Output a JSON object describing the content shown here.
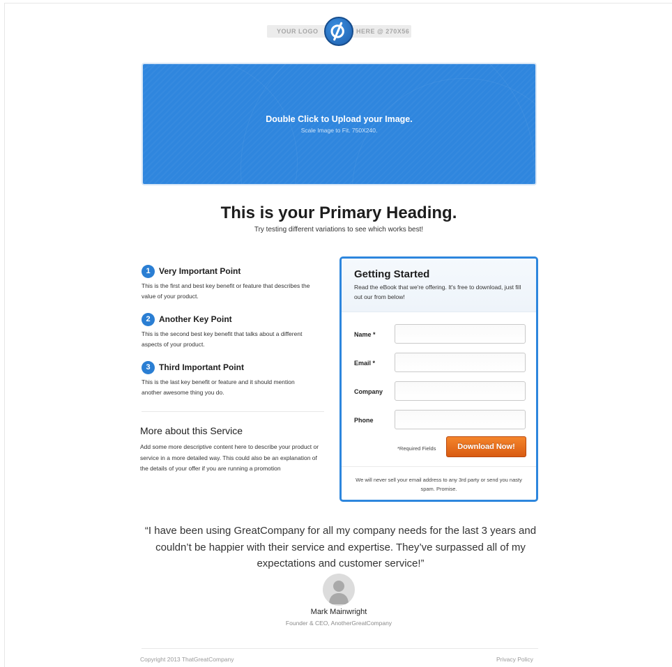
{
  "logo": {
    "left_text": "YOUR LOGO",
    "right_text": "HERE @ 270X56",
    "icon": "unbounce-logo-icon"
  },
  "hero": {
    "title": "Double Click to Upload your Image.",
    "subtitle": "Scale Image to Fit. 750X240.",
    "color": "#2f86de"
  },
  "primary_heading": "This is your Primary Heading.",
  "sub_heading": "Try testing different variations to see which works best!",
  "points": [
    {
      "num": "1",
      "title": "Very Important Point",
      "desc": "This is the first and best key benefit or feature that describes the value of your product."
    },
    {
      "num": "2",
      "title": "Another Key Point",
      "desc": "This is the second best key benefit that talks about a different aspects of your product."
    },
    {
      "num": "3",
      "title": "Third Important Point",
      "desc": "This is the last key benefit or feature and it should mention another awesome thing you do."
    }
  ],
  "more": {
    "title": "More about this Service",
    "desc": "Add some more descriptive content here to describe your product or service in a more detailed way. This could also be an explanation of the details of your offer if you are running a promotion"
  },
  "form": {
    "title": "Getting Started",
    "intro": "Read the eBook that we're offering. It's free to download, just fill out our from below!",
    "fields": [
      {
        "label": "Name *",
        "value": "",
        "placeholder": ""
      },
      {
        "label": "Email *",
        "value": "",
        "placeholder": ""
      },
      {
        "label": "Company",
        "value": "",
        "placeholder": ""
      },
      {
        "label": "Phone",
        "value": "",
        "placeholder": ""
      }
    ],
    "required_note": "*Required Fields",
    "button_label": "Download Now!",
    "footer": "We will never sell your email address to any 3rd party or send you nasty spam. Promise.",
    "border_color": "#2d86dd",
    "button_color": "#e8701e"
  },
  "testimonial": {
    "quote": "“I have been using GreatCompany for all my company needs for the last 3 years and couldn’t be happier with their service and expertise. They’ve surpassed all of my expectations and customer service!”",
    "author": "Mark Mainwright",
    "role": "Founder & CEO, AnotherGreatCompany",
    "avatar_icon": "user-avatar-icon"
  },
  "footer": {
    "copyright": "Copyright 2013 ThatGreatCompany",
    "privacy": "Privacy Policy"
  }
}
